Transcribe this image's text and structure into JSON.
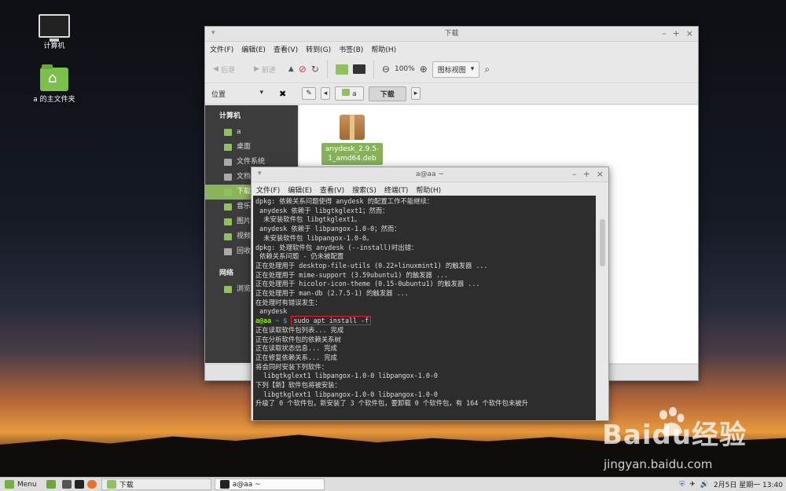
{
  "desktop": {
    "icons": [
      {
        "label": "计算机",
        "icon": "computer-icon"
      },
      {
        "label": "a 的主文件夹",
        "icon": "home-folder-icon"
      }
    ]
  },
  "file_manager": {
    "title": "下载",
    "menu": [
      "文件(F)",
      "编辑(E)",
      "查看(V)",
      "转到(G)",
      "书签(B)",
      "帮助(H)"
    ],
    "toolbar": {
      "back": "后退",
      "forward": "前进",
      "zoom": "100%",
      "view_mode": "图标视图"
    },
    "location_label": "位置",
    "breadcrumbs": [
      "a",
      "下载"
    ],
    "sidebar": {
      "computer_header": "计算机",
      "items": [
        "a",
        "桌面",
        "文件系统",
        "文档",
        "下载",
        "音乐",
        "图片",
        "视频",
        "回收站"
      ],
      "network_header": "网络",
      "network_items": [
        "浏览网络"
      ]
    },
    "file": {
      "name": "anydesk_2.9.5-1_amd64.deb"
    }
  },
  "terminal": {
    "title": "a@aa ~",
    "menu": [
      "文件(F)",
      "编辑(E)",
      "查看(V)",
      "搜索(S)",
      "终端(T)",
      "帮助(H)"
    ],
    "lines_before": [
      "dpkg: 依赖关系问题使得 anydesk 的配置工作不能继续：",
      " anydesk 依赖于 libgtkglext1；然而：",
      "  未安装软件包 libgtkglext1。",
      " anydesk 依赖于 libpangox-1.0-0；然而：",
      "  未安装软件包 libpangox-1.0-0。",
      "",
      "dpkg: 处理软件包 anydesk (--install)时出错：",
      " 依赖关系问题 - 仍未被配置",
      "正在处理用于 desktop-file-utils (0.22+linuxmint1) 的触发器 ...",
      "正在处理用于 mime-support (3.59ubuntu1) 的触发器 ...",
      "正在处理用于 hicolor-icon-theme (0.15-0ubuntu1) 的触发器 ...",
      "正在处理用于 man-db (2.7.5-1) 的触发器 ...",
      "在处理时有错误发生：",
      " anydesk"
    ],
    "prompt_user": "a@aa",
    "prompt_path": " ~ $",
    "command": "sudo apt install -f",
    "lines_after": [
      "正在读取软件包列表... 完成",
      "正在分析软件包的依赖关系树",
      "正在读取状态信息... 完成",
      "正在修复依赖关系... 完成",
      "将会同时安装下列软件：",
      "  libgtkglext1 libpangox-1.0-0 libpangox-1.0-0",
      "下列【新】软件包将被安装：",
      "  libgtkglext1 libpangox-1.0-0 libpangox-1.0-0",
      "升级了 0 个软件包，新安装了 3 个软件包，要卸载 0 个软件包，有 164 个软件包未被升"
    ]
  },
  "taskbar": {
    "menu": "Menu",
    "windows": [
      "下载",
      "a@aa ~"
    ],
    "clock": "2月5日 星期一 13:40"
  },
  "watermark": {
    "brand": "Baidu经验",
    "url": "jingyan.baidu.com"
  },
  "colors": {
    "accent_green": "#8ab45b",
    "terminal_bg": "#2d2d2d",
    "highlight_red": "#e0202a"
  }
}
